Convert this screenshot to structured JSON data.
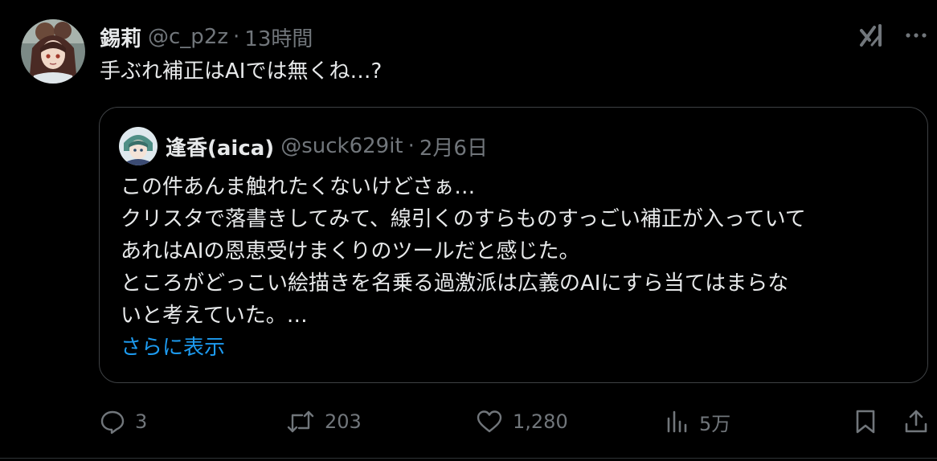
{
  "tweet": {
    "author": {
      "display_name": "錫莉",
      "handle": "@c_p2z",
      "avatar_icon": "avatar-anime-girl"
    },
    "separator": "·",
    "time": "13時間",
    "text": "手ぶれ補正はAIでは無くね…?",
    "top_icons": [
      "grok-icon",
      "more-icon"
    ]
  },
  "quote": {
    "author": {
      "display_name": "逢香(aica)",
      "handle": "@suck629it",
      "avatar_icon": "avatar-anime-character"
    },
    "separator": "·",
    "date": "2月6日",
    "lines": [
      "この件あんま触れたくないけどさぁ…",
      "クリスタで落書きしてみて、線引くのすらものすっごい補正が入っていて",
      "あれはAIの恩恵受けまくりのツールだと感じた。",
      "ところがどっこい絵描きを名乗る過激派は広義のAIにすら当てはまらな",
      "いと考えていた。…"
    ],
    "show_more": "さらに表示"
  },
  "actions": {
    "reply_count": "3",
    "retweet_count": "203",
    "like_count": "1,280",
    "views_count": "5万"
  },
  "colors": {
    "background": "#000000",
    "text_primary": "#e7e9ea",
    "text_secondary": "#71767b",
    "link": "#1d9bf0",
    "border": "#3e4144"
  }
}
